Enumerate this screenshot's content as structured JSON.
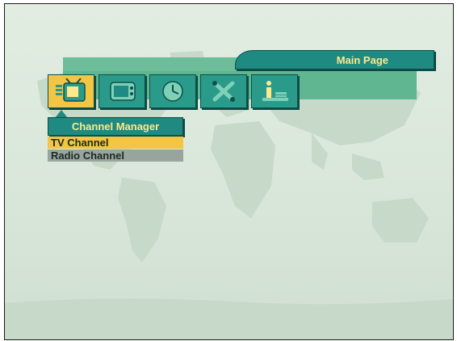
{
  "main_page": {
    "title": "Main Page"
  },
  "icons": [
    {
      "name": "channel-manager-icon",
      "selected": true
    },
    {
      "name": "installation-icon",
      "selected": false
    },
    {
      "name": "timer-icon",
      "selected": false
    },
    {
      "name": "tools-icon",
      "selected": false
    },
    {
      "name": "information-icon",
      "selected": false
    }
  ],
  "submenu": {
    "title": "Channel Manager",
    "items": [
      {
        "label": "TV Channel",
        "selected": true
      },
      {
        "label": "Radio Channel",
        "selected": false
      }
    ]
  },
  "colors": {
    "teal": "#1e8a81",
    "band": "#5fb691",
    "highlight": "#f2c544",
    "title_text": "#ffe98a",
    "item_grey": "#9aa49e"
  }
}
